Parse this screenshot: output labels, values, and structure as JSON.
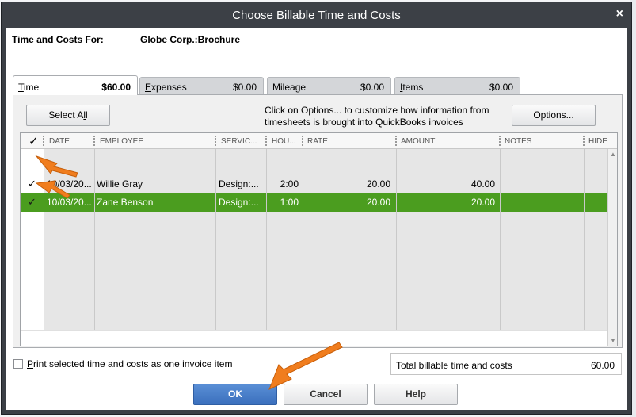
{
  "window": {
    "title": "Choose Billable Time and Costs",
    "close_glyph": "×"
  },
  "header": {
    "label": "Time and Costs For:",
    "value": "Globe Corp.:Brochure"
  },
  "tabs": [
    {
      "label_underline": "T",
      "label_rest": "ime",
      "amount": "$60.00",
      "active": true
    },
    {
      "label_underline": "E",
      "label_rest": "xpenses",
      "amount": "$0.00",
      "active": false
    },
    {
      "label_pre": "Milea",
      "label_underline": "g",
      "label_rest": "e",
      "amount": "$0.00",
      "active": false
    },
    {
      "label_underline": "I",
      "label_rest": "tems",
      "amount": "$0.00",
      "active": false
    }
  ],
  "toolbar": {
    "select_all_pre": "Select A",
    "select_all_underline": "l",
    "select_all_post": "l",
    "info": "Click on Options... to customize how information from timesheets is brought into QuickBooks invoices",
    "options_label": "Options..."
  },
  "grid": {
    "check_header": "✓",
    "columns": [
      "DATE",
      "EMPLOYEE",
      "SERVIC...",
      "HOU...",
      "RATE",
      "AMOUNT",
      "NOTES",
      "HIDE"
    ],
    "rows": [
      {
        "checked": "✓",
        "date": "10/03/20...",
        "employee": "Willie Gray",
        "service": "Design:...",
        "hours": "2:00",
        "rate": "20.00",
        "amount": "40.00",
        "notes": "",
        "selected": false
      },
      {
        "checked": "✓",
        "date": "10/03/20...",
        "employee": "Zane Benson",
        "service": "Design:...",
        "hours": "1:00",
        "rate": "20.00",
        "amount": "20.00",
        "notes": "",
        "selected": true
      }
    ]
  },
  "footer": {
    "print_label_underline": "P",
    "print_label_rest": "rint selected time and costs as one invoice item",
    "total_label": "Total billable time and costs",
    "total_value": "60.00",
    "ok_label": "OK",
    "cancel_label": "Cancel",
    "help_label": "Help"
  },
  "colors": {
    "selected_row": "#4b9d1f",
    "primary_button": "#3a6fbd",
    "annotation_arrow": "#f07d1e"
  }
}
